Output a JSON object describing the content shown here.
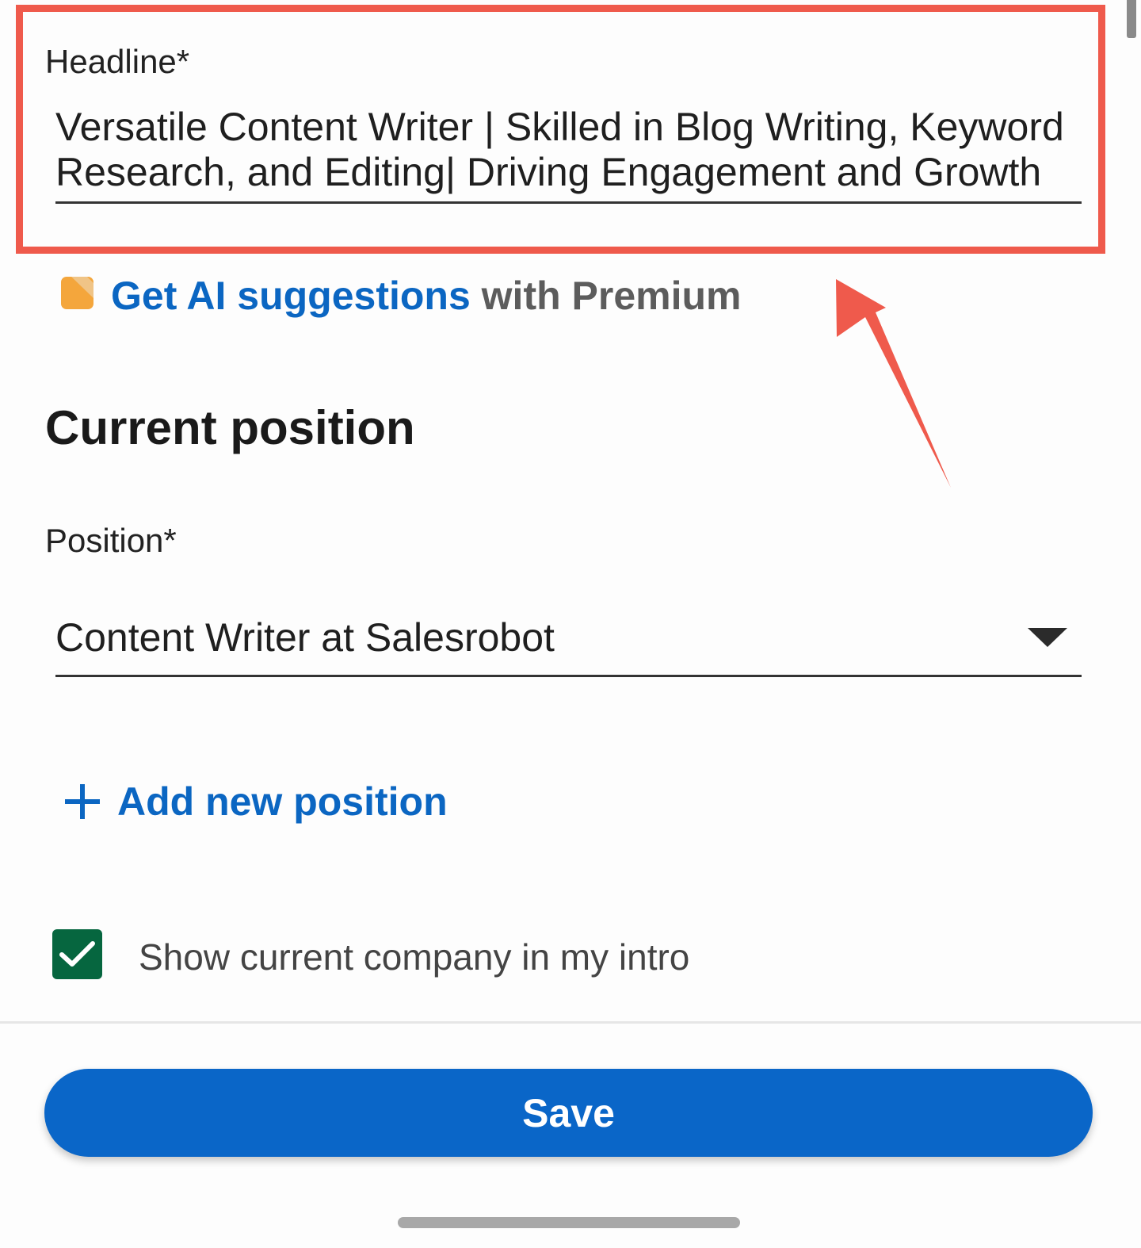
{
  "headline": {
    "label": "Headline*",
    "value": "Versatile Content Writer | Skilled in Blog Writing, Keyword Research, and Editing| Driving Engagement and Growth"
  },
  "premium": {
    "icon": "premium-badge-icon",
    "link_text": "Get AI suggestions",
    "rest_text": " with Premium"
  },
  "current_position": {
    "title": "Current position",
    "position_label": "Position*",
    "position_value": "Content Writer at Salesrobot",
    "add_label": "Add new position"
  },
  "intro": {
    "show_company_label": "Show current company in my intro",
    "checked": true
  },
  "save_label": "Save",
  "colors": {
    "highlight": "#ef5a4c",
    "link": "#0b66c2",
    "checkbox": "#06663f",
    "save_button": "#0a66c8",
    "premium_icon": "#f4a63c"
  }
}
